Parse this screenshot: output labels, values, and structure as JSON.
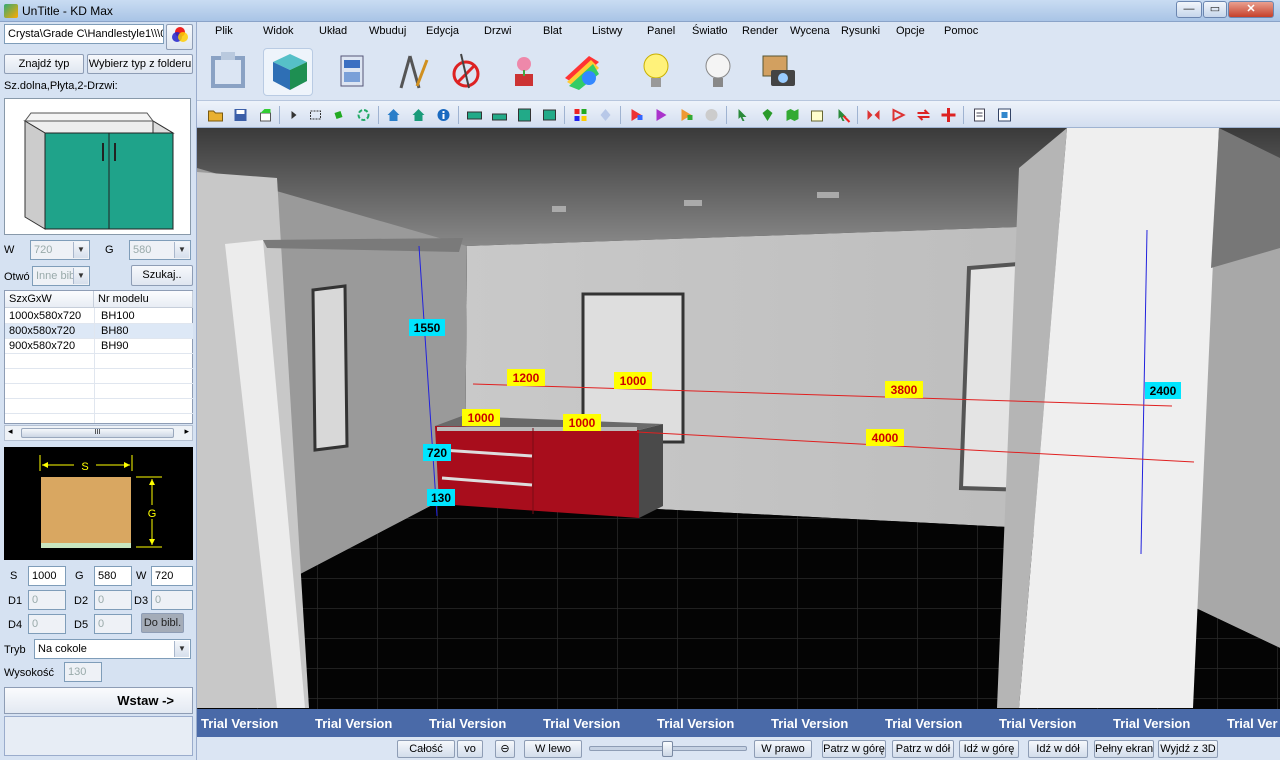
{
  "window": {
    "title": "UnTitle - KD Max",
    "min": "—",
    "max": "▭",
    "close": "✕"
  },
  "left": {
    "path": "Crysta\\Grade C\\Handlestyle1\\\\\\0",
    "find_type": "Znajdź typ",
    "choose_folder": "Wybierz typ z folderu",
    "item_desc": "Sz.dolna,Płyta,2-Drzwi:",
    "w_label": "W",
    "w_value": "720",
    "g_label": "G",
    "g_value": "580",
    "otw_label": "Otwó",
    "otw_value": "Inne bib",
    "search": "Szukaj..",
    "columns": [
      "SzxGxW",
      "Nr modelu"
    ],
    "rows": [
      [
        "1000x580x720",
        "BH100"
      ],
      [
        "800x580x720",
        "BH80"
      ],
      [
        "900x580x720",
        "BH90"
      ]
    ],
    "scroll_grip": "III",
    "drawing_s": "S",
    "drawing_g": "G",
    "s_label": "S",
    "s_value": "1000",
    "g2_label": "G",
    "g2_value": "580",
    "w2_label": "W",
    "w2_value": "720",
    "d1_label": "D1",
    "d1_value": "0",
    "d2_label": "D2",
    "d2_value": "0",
    "d3_label": "D3",
    "d3_value": "0",
    "d4_label": "D4",
    "d4_value": "0",
    "d5_label": "D5",
    "d5_value": "0",
    "do_bibl": "Do bibl.",
    "tryb_label": "Tryb",
    "tryb_value": "Na cokole",
    "wys_label": "Wysokość",
    "wys_value": "130",
    "insert": "Wstaw ->"
  },
  "menu": [
    "Plik",
    "Widok",
    "Układ",
    "Wbuduj",
    "Edycja",
    "Drzwi",
    "Blat",
    "Listwy",
    "Panel",
    "Światło",
    "Render",
    "Wycena",
    "Rysunki",
    "Opcje",
    "Pomoc"
  ],
  "viewport": {
    "dims": {
      "d1550": "1550",
      "d1200": "1200",
      "d1000a": "1000",
      "d3800": "3800",
      "d2400": "2400",
      "d1000b": "1000",
      "d1000c": "1000",
      "d4000": "4000",
      "d720": "720",
      "d130": "130"
    },
    "trial": "Trial Version",
    "trial_short": "Trial Ver"
  },
  "bottom": {
    "all": "Całość",
    "vo": "vo",
    "zoom": "⊖",
    "left": "W lewo",
    "right": "W prawo",
    "up": "Patrz w górę",
    "down": "Patrz w dół",
    "go_up": "Idź w górę",
    "go_down": "Idź w dół",
    "full": "Pełny ekran",
    "exit3d": "Wyjdź z 3D"
  },
  "colors": {
    "cabinet": "#a80d1c",
    "front_preview": "#1fa38a",
    "dim_label": "#ffff00",
    "dim_label_blue": "#00e5ff",
    "dim_line": "#e02020"
  }
}
